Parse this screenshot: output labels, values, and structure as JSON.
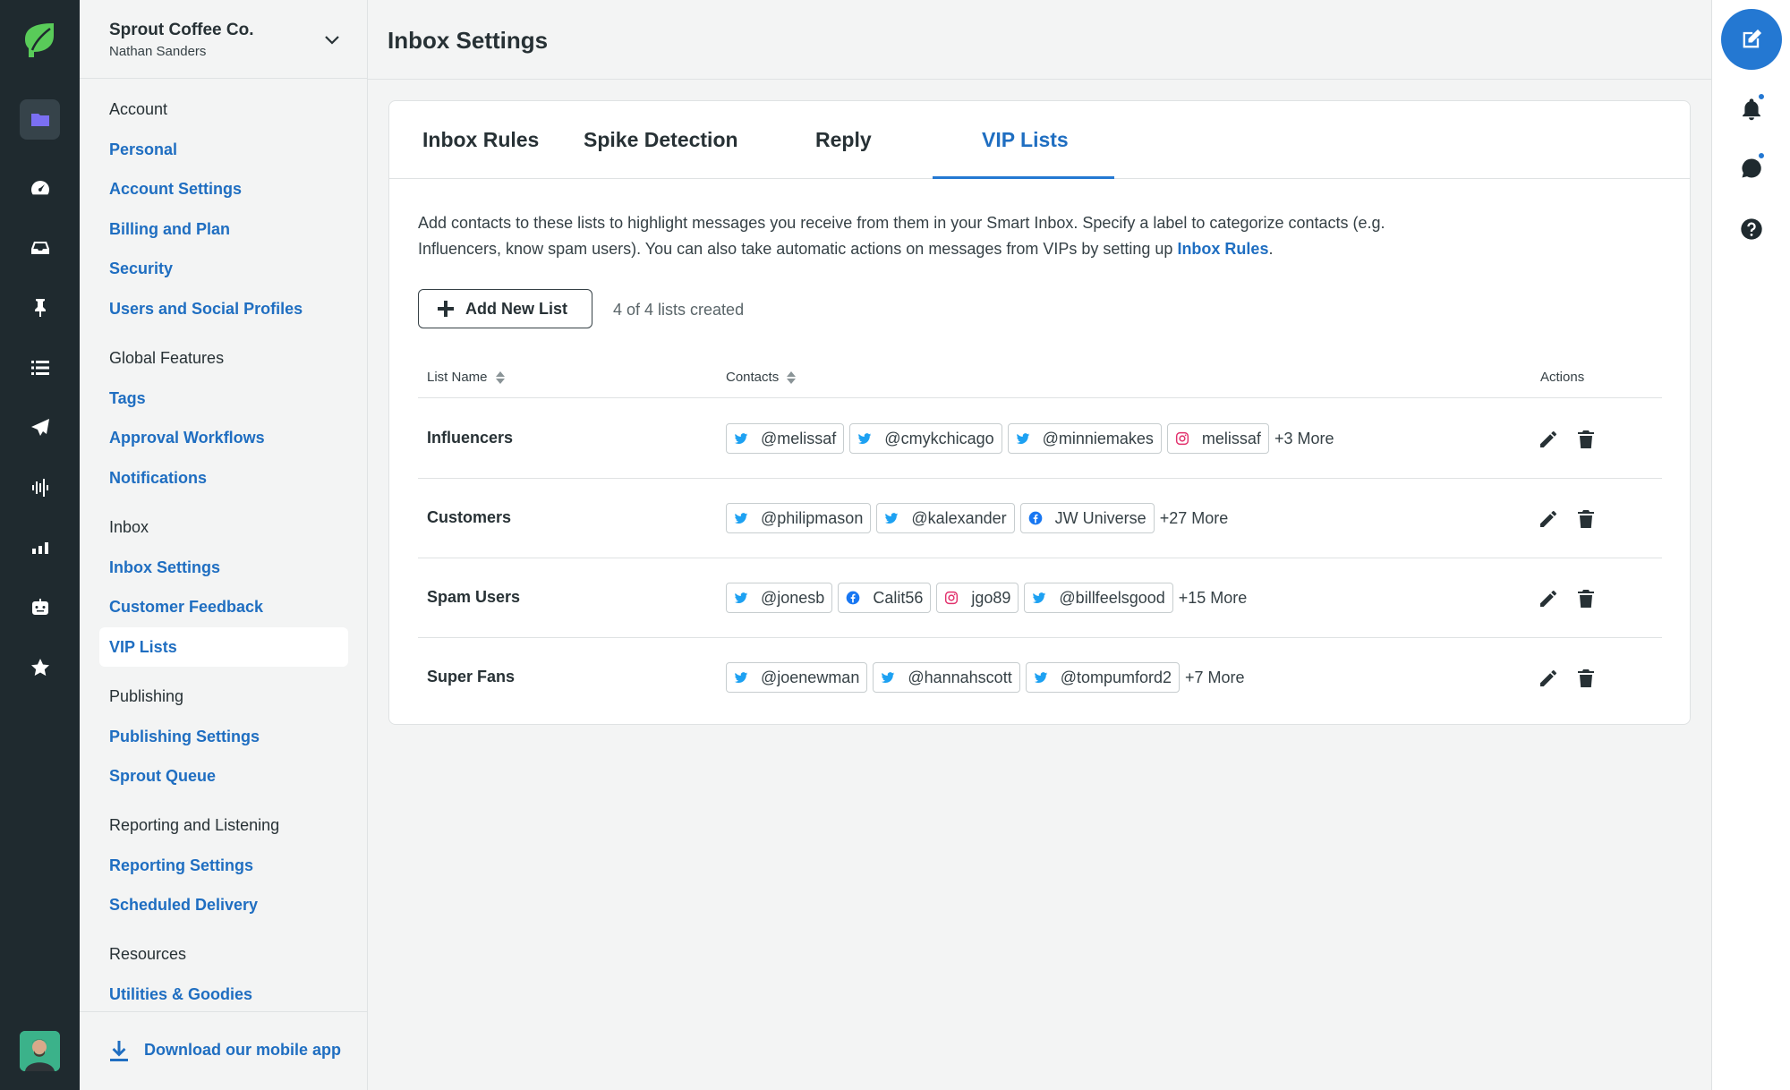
{
  "org": {
    "name": "Sprout Coffee Co.",
    "user": "Nathan Sanders"
  },
  "sidebar": {
    "sections": [
      {
        "heading": "Account",
        "items": [
          "Personal",
          "Account Settings",
          "Billing and Plan",
          "Security",
          "Users and Social Profiles"
        ]
      },
      {
        "heading": "Global Features",
        "items": [
          "Tags",
          "Approval Workflows",
          "Notifications"
        ]
      },
      {
        "heading": "Inbox",
        "items": [
          "Inbox Settings",
          "Customer Feedback",
          "VIP Lists"
        ]
      },
      {
        "heading": "Publishing",
        "items": [
          "Publishing Settings",
          "Sprout Queue"
        ]
      },
      {
        "heading": "Reporting and Listening",
        "items": [
          "Reporting Settings",
          "Scheduled Delivery"
        ]
      },
      {
        "heading": "Resources",
        "items": [
          "Utilities & Goodies"
        ]
      }
    ],
    "selected": "VIP Lists",
    "download_label": "Download our mobile app"
  },
  "header": {
    "title": "Inbox Settings"
  },
  "tabs": [
    {
      "label": "Inbox Rules"
    },
    {
      "label": "Spike Detection"
    },
    {
      "label": "Reply"
    },
    {
      "label": "VIP Lists"
    }
  ],
  "active_tab": "VIP Lists",
  "description": {
    "text": "Add contacts to these lists to highlight messages you receive from them in your Smart Inbox. Specify a label to categorize contacts (e.g. Influencers, know spam users). You can also take automatic actions on messages from VIPs by setting up ",
    "link": "Inbox Rules",
    "end": "."
  },
  "add_button_label": "Add New List",
  "list_count": "4 of 4 lists created",
  "table": {
    "columns": [
      "List Name",
      "Contacts",
      "Actions"
    ],
    "rows": [
      {
        "name": "Influencers",
        "contacts": [
          {
            "network": "twitter",
            "handle": "@melissaf"
          },
          {
            "network": "twitter",
            "handle": "@cmykchicago"
          },
          {
            "network": "twitter",
            "handle": "@minniemakes"
          },
          {
            "network": "instagram",
            "handle": "melissaf"
          }
        ],
        "more": "+3 More"
      },
      {
        "name": "Customers",
        "contacts": [
          {
            "network": "twitter",
            "handle": "@philipmason"
          },
          {
            "network": "twitter",
            "handle": "@kalexander"
          },
          {
            "network": "facebook",
            "handle": "JW Universe"
          }
        ],
        "more": "+27 More"
      },
      {
        "name": "Spam Users",
        "contacts": [
          {
            "network": "twitter",
            "handle": "@jonesb"
          },
          {
            "network": "facebook",
            "handle": "Calit56"
          },
          {
            "network": "instagram",
            "handle": "jgo89"
          },
          {
            "network": "twitter",
            "handle": "@billfeelsgood"
          }
        ],
        "more": "+15 More"
      },
      {
        "name": "Super Fans",
        "contacts": [
          {
            "network": "twitter",
            "handle": "@joenewman"
          },
          {
            "network": "twitter",
            "handle": "@hannahscott"
          },
          {
            "network": "twitter",
            "handle": "@tompumford2"
          }
        ],
        "more": "+7 More"
      }
    ]
  },
  "colors": {
    "accent": "#2478d2",
    "link": "#1f6ec1",
    "rail": "#1f2a2f",
    "brand_green": "#59cb59",
    "twitter": "#1da1f2",
    "facebook": "#1877f2",
    "instagram": "#e1306c"
  },
  "icons": {
    "rail": [
      "folder-icon",
      "gauge-icon",
      "inbox-icon",
      "pin-icon",
      "list-icon",
      "paper-plane-icon",
      "waveform-icon",
      "bar-chart-icon",
      "bot-icon",
      "star-icon"
    ],
    "right_rail": [
      "compose-icon",
      "bell-icon",
      "feedback-icon",
      "help-icon"
    ],
    "row_actions": [
      "pencil-icon",
      "trash-icon"
    ]
  }
}
